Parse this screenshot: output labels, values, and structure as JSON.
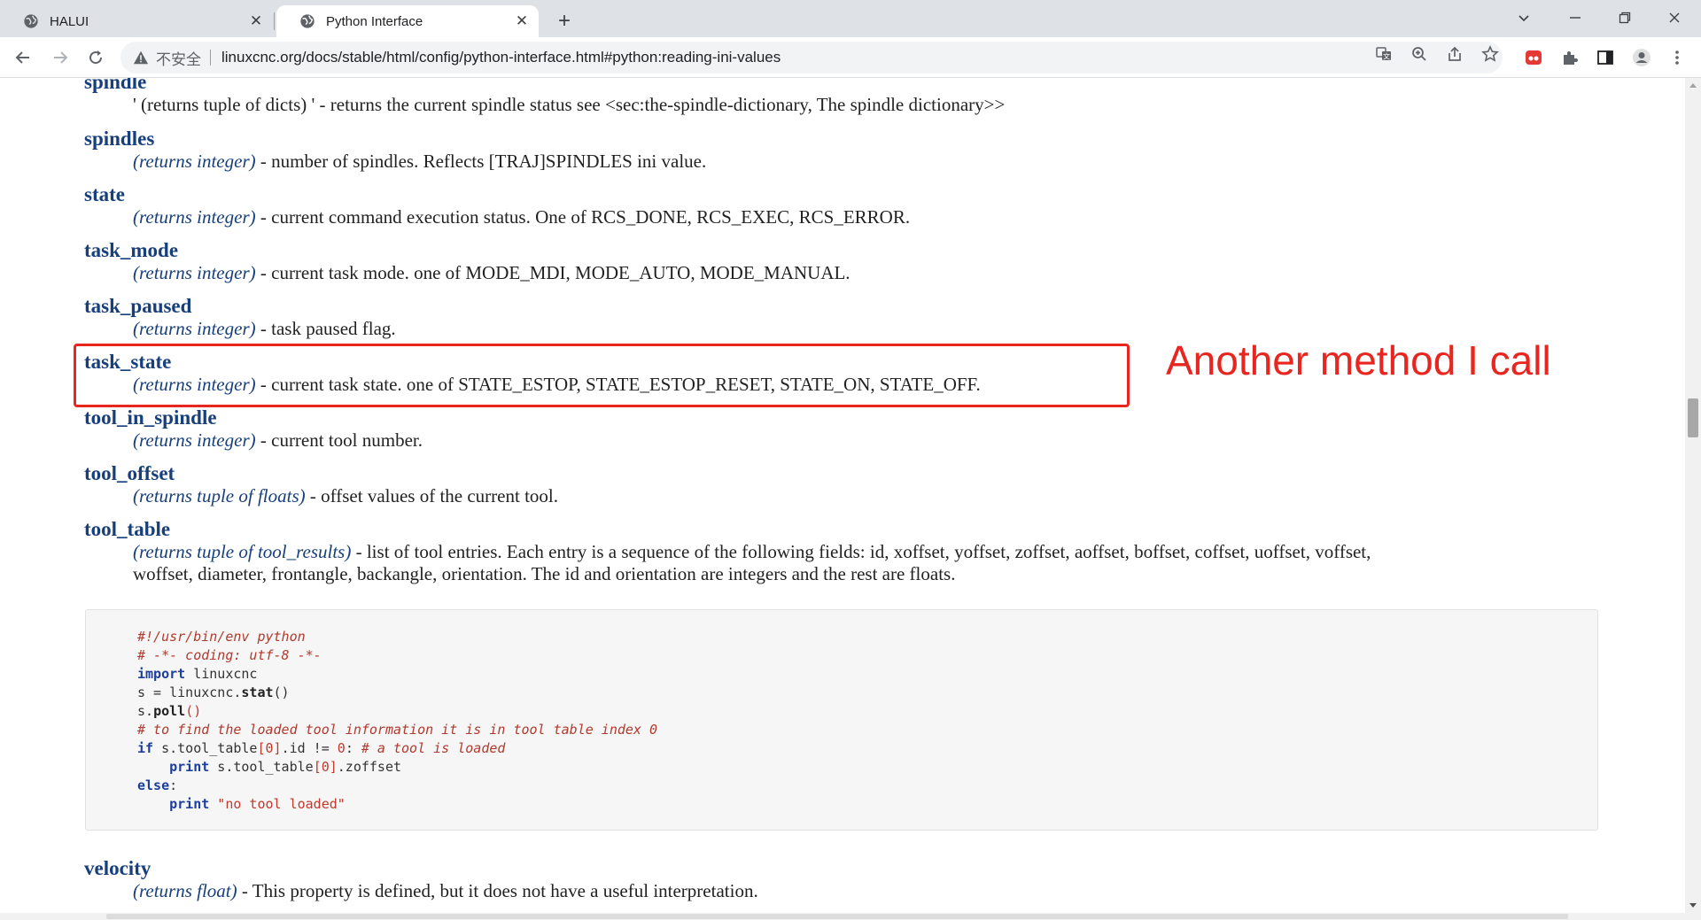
{
  "tabs": [
    {
      "title": "HALUI",
      "active": false
    },
    {
      "title": "Python Interface",
      "active": true
    }
  ],
  "omnibox": {
    "security_label": "不安全",
    "url": "linuxcnc.org/docs/stable/html/config/python-interface.html#python:reading-ini-values"
  },
  "entries": [
    {
      "term": "spindle",
      "ret": "",
      "desc": "' (returns tuple of dicts) ' - returns the current spindle status see <sec:the-spindle-dictionary, The spindle dictionary>>"
    },
    {
      "term": "spindles",
      "ret": "(returns integer)",
      "desc": " - number of spindles. Reflects [TRAJ]SPINDLES ini value."
    },
    {
      "term": "state",
      "ret": "(returns integer)",
      "desc": " - current command execution status. One of RCS_DONE, RCS_EXEC, RCS_ERROR."
    },
    {
      "term": "task_mode",
      "ret": "(returns integer)",
      "desc": " - current task mode. one of MODE_MDI, MODE_AUTO, MODE_MANUAL."
    },
    {
      "term": "task_paused",
      "ret": "(returns integer)",
      "desc": " - task paused flag."
    },
    {
      "term": "task_state",
      "ret": "(returns integer)",
      "desc": " - current task state. one of STATE_ESTOP, STATE_ESTOP_RESET, STATE_ON, STATE_OFF."
    },
    {
      "term": "tool_in_spindle",
      "ret": "(returns integer)",
      "desc": " - current tool number."
    },
    {
      "term": "tool_offset",
      "ret": "(returns tuple of floats)",
      "desc": " - offset values of the current tool."
    },
    {
      "term": "tool_table",
      "ret": "(returns tuple of tool_results)",
      "desc": " - list of tool entries. Each entry is a sequence of the following fields: id, xoffset, yoffset, zoffset, aoffset, boffset, coffset, uoffset, voffset,",
      "desc2": "woffset, diameter, frontangle, backangle, orientation. The id and orientation are integers and the rest are floats."
    },
    {
      "term": "velocity",
      "ret": "(returns float)",
      "desc": " - This property is defined, but it does not have a useful interpretation."
    }
  ],
  "code": {
    "shebang": "#!/usr/bin/env python",
    "coding": "# -*- coding: utf-8 -*-",
    "kw_import": "import",
    "import_name": " linuxcnc",
    "s_assign": "s = linuxcnc.",
    "stat_fn": "stat",
    "parens": "()",
    "s_dot": "s.",
    "poll_fn": "poll",
    "comment_find": "# to find the loaded tool information it is in tool table index 0",
    "kw_if": "if",
    "if_expr_a": " s.tool_table",
    "idx0": "[0]",
    "if_expr_b": ".id != ",
    "zero": "0",
    "colon_sp": ": ",
    "comment_loaded": "# a tool is loaded",
    "kw_print": "print",
    "print_expr_a": " s.tool_table",
    "print_expr_b": ".zoffset",
    "kw_else": "else",
    "colon": ":",
    "str_none": " \"no tool loaded\""
  },
  "annotation": {
    "text": "Another method I call",
    "color": "#e8251e"
  },
  "colors": {
    "term": "#173f7b",
    "chrome_bg": "#dee1e6",
    "code_bg": "#f6f6f6"
  }
}
